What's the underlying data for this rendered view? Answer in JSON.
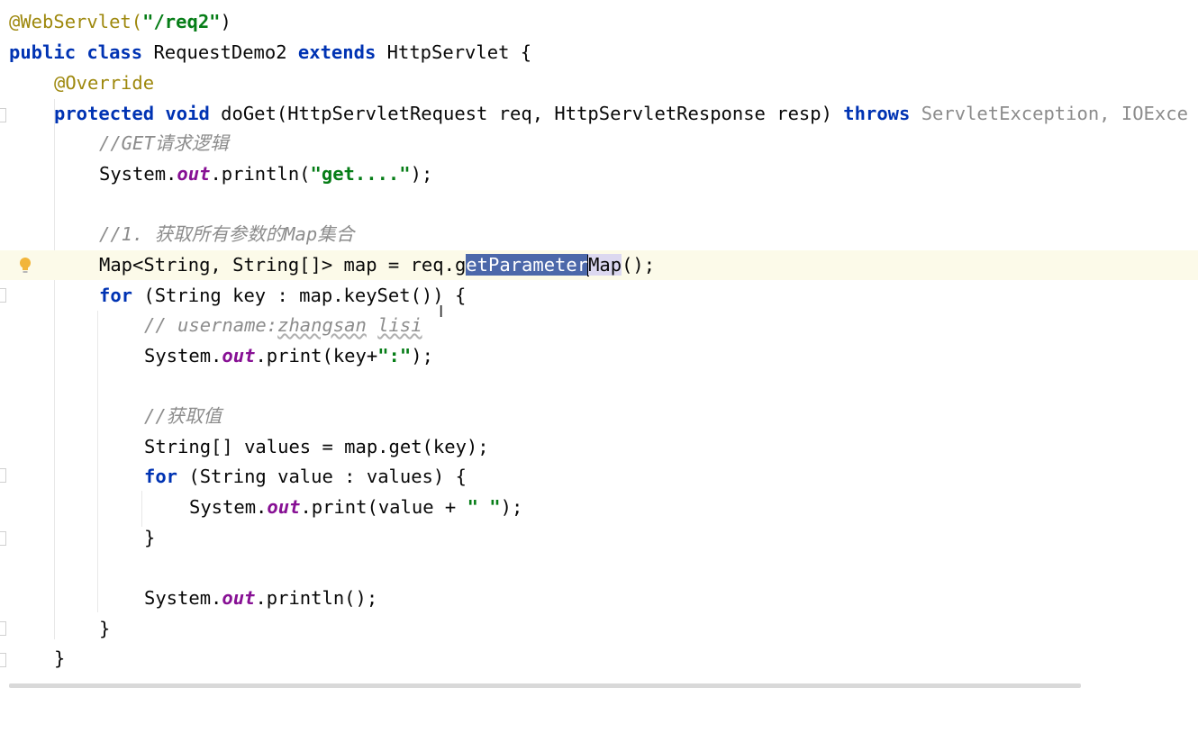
{
  "code_lines": {
    "l1": {
      "a": "@WebServlet(",
      "b": "\"/req2\"",
      "c": ")"
    },
    "l2": {
      "k1": "public class",
      "a": " RequestDemo2 ",
      "k2": "extends",
      "b": " HttpServlet {"
    },
    "l3": {
      "a": "@Override"
    },
    "l4": {
      "k1": "protected void",
      "a": " doGet(HttpServletRequest req, HttpServletResponse resp) ",
      "k2": "throws",
      "b": " ServletException, IOExce"
    },
    "l5": {
      "a": "//GET请求逻辑"
    },
    "l6": {
      "a": "System.",
      "f": "out",
      "b": ".println(",
      "s": "\"get....\"",
      "c": ");"
    },
    "l8": {
      "a": "//1. 获取所有参数的Map集合"
    },
    "l9": {
      "a": "Map<String, String[]> map = req.g",
      "sel": "etParameter",
      "rest": "Map",
      "b": "();"
    },
    "l10": {
      "k": "for",
      "a": " (String key : map.keySet()) {"
    },
    "l11": {
      "a": "// username:",
      "u1": "zhangsan",
      "sp": " ",
      "u2": "lisi"
    },
    "l12": {
      "a": "System.",
      "f": "out",
      "b": ".print(key+",
      "s": "\":\"",
      "c": ");"
    },
    "l14": {
      "a": "//获取值"
    },
    "l15": {
      "a": "String[] values = map.get(key);"
    },
    "l16": {
      "k": "for",
      "a": " (String value : values) {"
    },
    "l17": {
      "a": "System.",
      "f": "out",
      "b": ".print(value + ",
      "s": "\" \"",
      "c": ");"
    },
    "l18": {
      "a": "}"
    },
    "l20": {
      "a": "System.",
      "f": "out",
      "b": ".println();"
    },
    "l21": {
      "a": "}"
    },
    "l22": {
      "a": "}"
    }
  },
  "icons": {
    "intention": "lightbulb-icon",
    "cursor": "text-cursor-icon"
  },
  "colors": {
    "keyword": "#0033b3",
    "annotation": "#9e880d",
    "string": "#067d17",
    "field": "#871094",
    "comment": "#8c8c8c",
    "selection": "#4c68aa",
    "current_line": "#fcfae9"
  }
}
